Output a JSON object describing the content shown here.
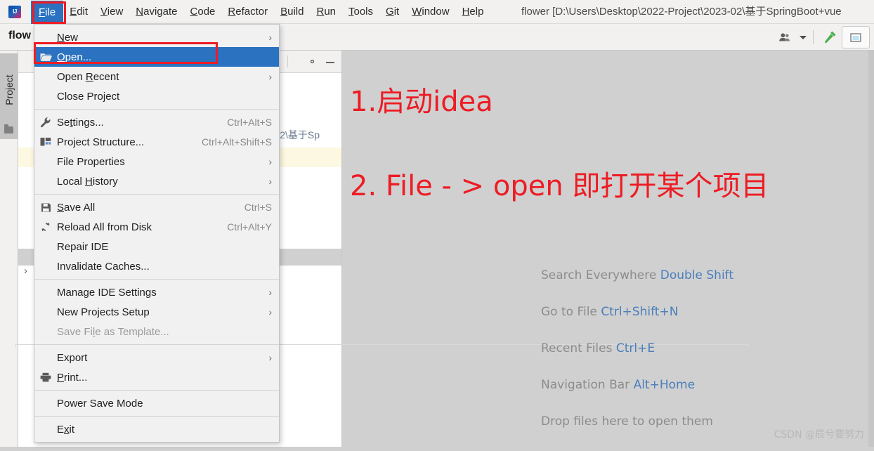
{
  "window": {
    "title": "flower [D:\\Users\\Desktop\\2022-Project\\2023-02\\基于SpringBoot+vue",
    "app_logo": "intellij-idea-logo"
  },
  "menubar": {
    "items": [
      {
        "label": "File",
        "mnemonic": "F",
        "active": true
      },
      {
        "label": "Edit",
        "mnemonic": "E",
        "active": false
      },
      {
        "label": "View",
        "mnemonic": "V",
        "active": false
      },
      {
        "label": "Navigate",
        "mnemonic": "N",
        "active": false
      },
      {
        "label": "Code",
        "mnemonic": "C",
        "active": false
      },
      {
        "label": "Refactor",
        "mnemonic": "R",
        "active": false
      },
      {
        "label": "Build",
        "mnemonic": "B",
        "active": false
      },
      {
        "label": "Run",
        "mnemonic": "R",
        "active": false
      },
      {
        "label": "Tools",
        "mnemonic": "T",
        "active": false
      },
      {
        "label": "Git",
        "mnemonic": "G",
        "active": false
      },
      {
        "label": "Window",
        "mnemonic": "W",
        "active": false
      },
      {
        "label": "Help",
        "mnemonic": "H",
        "active": false
      }
    ]
  },
  "navbar": {
    "project_label": "flow",
    "icons": [
      "user-account-icon",
      "chevron-down-icon",
      "build-hammer-icon",
      "restore-window-icon"
    ]
  },
  "left_strip": {
    "project_tab_label": "Project",
    "project_tab_icon": "folder-icon"
  },
  "project_panel": {
    "path_fragment": "3-02\\基于Sp",
    "header_icons": [
      "gear-icon",
      "minimize-icon"
    ],
    "expander_glyph": "›",
    "collapse_glyph": "⌄"
  },
  "file_menu": {
    "groups": [
      [
        {
          "icon": "",
          "label": "New",
          "mnemonic": "N",
          "shortcut": "",
          "submenu": true,
          "selected": false,
          "disabled": false
        },
        {
          "icon": "open-folder-icon",
          "label": "Open...",
          "mnemonic": "O",
          "shortcut": "",
          "submenu": false,
          "selected": true,
          "disabled": false
        },
        {
          "icon": "",
          "label": "Open Recent",
          "mnemonic": "R",
          "shortcut": "",
          "submenu": true,
          "selected": false,
          "disabled": false
        },
        {
          "icon": "",
          "label": "Close Project",
          "mnemonic": "",
          "shortcut": "",
          "submenu": false,
          "selected": false,
          "disabled": false
        }
      ],
      [
        {
          "icon": "wrench-icon",
          "label": "Settings...",
          "mnemonic": "t",
          "shortcut": "Ctrl+Alt+S",
          "submenu": false,
          "selected": false,
          "disabled": false
        },
        {
          "icon": "project-structure-icon",
          "label": "Project Structure...",
          "mnemonic": "",
          "shortcut": "Ctrl+Alt+Shift+S",
          "submenu": false,
          "selected": false,
          "disabled": false
        },
        {
          "icon": "",
          "label": "File Properties",
          "mnemonic": "",
          "shortcut": "",
          "submenu": true,
          "selected": false,
          "disabled": false
        },
        {
          "icon": "",
          "label": "Local History",
          "mnemonic": "H",
          "shortcut": "",
          "submenu": true,
          "selected": false,
          "disabled": false
        }
      ],
      [
        {
          "icon": "save-disk-icon",
          "label": "Save All",
          "mnemonic": "S",
          "shortcut": "Ctrl+S",
          "submenu": false,
          "selected": false,
          "disabled": false
        },
        {
          "icon": "reload-icon",
          "label": "Reload All from Disk",
          "mnemonic": "",
          "shortcut": "Ctrl+Alt+Y",
          "submenu": false,
          "selected": false,
          "disabled": false
        },
        {
          "icon": "",
          "label": "Repair IDE",
          "mnemonic": "",
          "shortcut": "",
          "submenu": false,
          "selected": false,
          "disabled": false
        },
        {
          "icon": "",
          "label": "Invalidate Caches...",
          "mnemonic": "",
          "shortcut": "",
          "submenu": false,
          "selected": false,
          "disabled": false
        }
      ],
      [
        {
          "icon": "",
          "label": "Manage IDE Settings",
          "mnemonic": "",
          "shortcut": "",
          "submenu": true,
          "selected": false,
          "disabled": false
        },
        {
          "icon": "",
          "label": "New Projects Setup",
          "mnemonic": "",
          "shortcut": "",
          "submenu": true,
          "selected": false,
          "disabled": false
        },
        {
          "icon": "",
          "label": "Save File as Template...",
          "mnemonic": "l",
          "shortcut": "",
          "submenu": false,
          "selected": false,
          "disabled": true
        }
      ],
      [
        {
          "icon": "",
          "label": "Export",
          "mnemonic": "",
          "shortcut": "",
          "submenu": true,
          "selected": false,
          "disabled": false
        },
        {
          "icon": "printer-icon",
          "label": "Print...",
          "mnemonic": "P",
          "shortcut": "",
          "submenu": false,
          "selected": false,
          "disabled": false
        }
      ],
      [
        {
          "icon": "",
          "label": "Power Save Mode",
          "mnemonic": "",
          "shortcut": "",
          "submenu": false,
          "selected": false,
          "disabled": false
        }
      ],
      [
        {
          "icon": "",
          "label": "Exit",
          "mnemonic": "x",
          "shortcut": "",
          "submenu": false,
          "selected": false,
          "disabled": false
        }
      ]
    ]
  },
  "annotations": {
    "line1": "1.启动idea",
    "line2": "2. File - > open 即打开某个项目",
    "color": "#ed1c24",
    "highlight_boxes": [
      {
        "target": "File menu item in menubar",
        "color": "#ee1c25"
      },
      {
        "target": "Open... item in File dropdown",
        "color": "#ee1c25"
      }
    ]
  },
  "hints": [
    {
      "action": "Search Everywhere",
      "key": "Double Shift"
    },
    {
      "action": "Go to File",
      "key": "Ctrl+Shift+N"
    },
    {
      "action": "Recent Files",
      "key": "Ctrl+E"
    },
    {
      "action": "Navigation Bar",
      "key": "Alt+Home"
    },
    {
      "action": "Drop files here to open them",
      "key": ""
    }
  ],
  "watermark": "CSDN @辰兮要努力",
  "colors": {
    "selection_blue": "#2b72c0",
    "annotation_red": "#ed1c24",
    "hint_key_blue": "#4a7ebb",
    "hint_text_gray": "#8c8c8c",
    "workspace_bg": "#d0d0d0",
    "menu_bg": "#f1f1f1"
  }
}
